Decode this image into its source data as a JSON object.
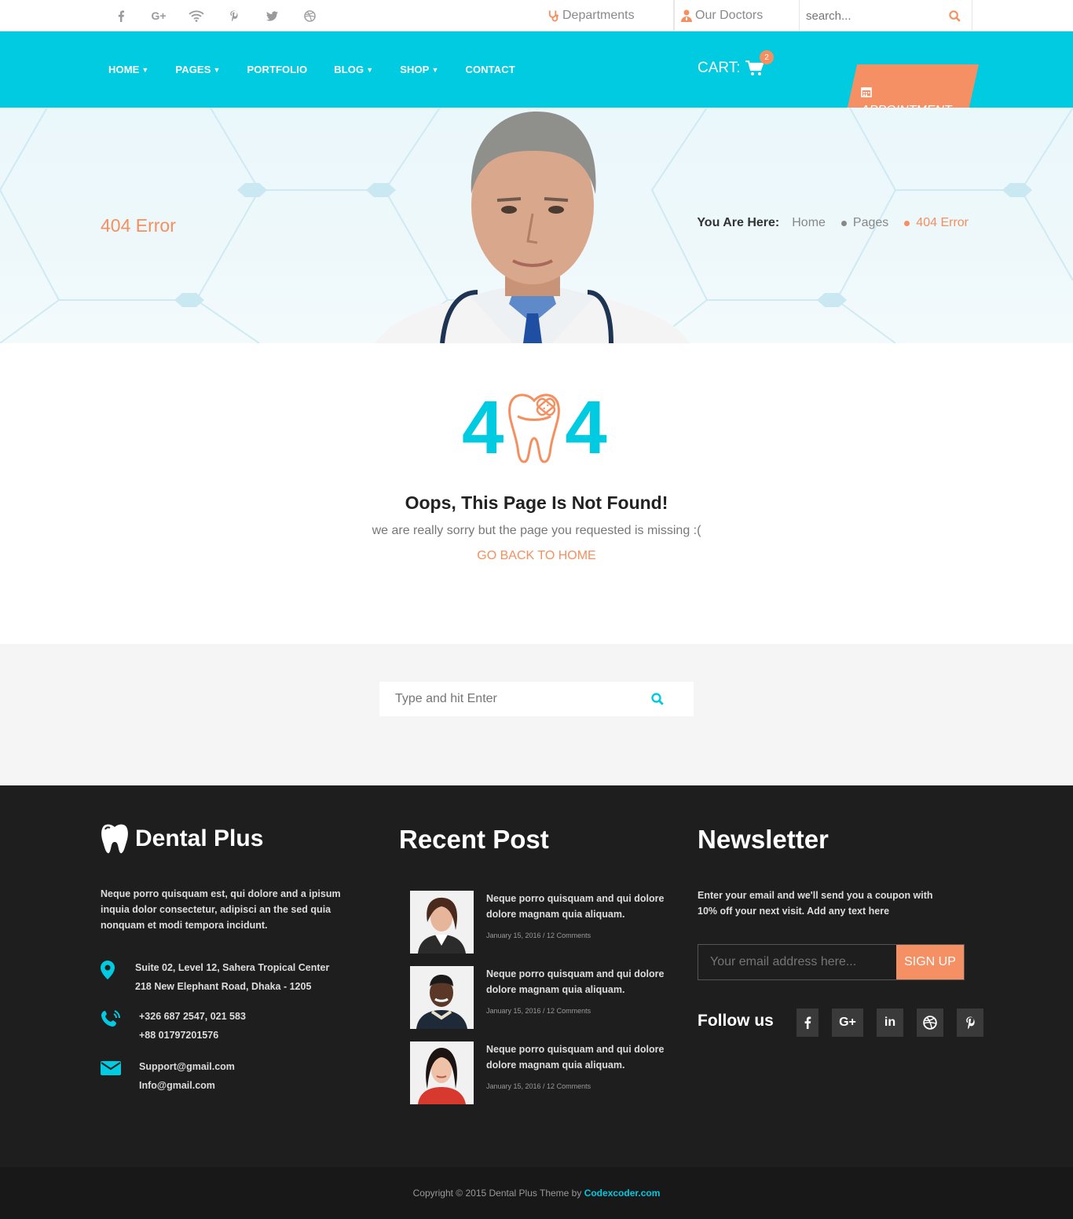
{
  "topbar": {
    "social": [
      "facebook-icon",
      "google-plus-icon",
      "wifi-icon",
      "pinterest-icon",
      "twitter-icon",
      "dribbble-icon"
    ],
    "departments": "Departments",
    "doctors": "Our Doctors",
    "search_placeholder": "search..."
  },
  "nav": {
    "items": [
      {
        "label": "HOME",
        "dropdown": true
      },
      {
        "label": "PAGES",
        "dropdown": true
      },
      {
        "label": "PORTFOLIO",
        "dropdown": false
      },
      {
        "label": "BLOG",
        "dropdown": true
      },
      {
        "label": "SHOP",
        "dropdown": true
      },
      {
        "label": "CONTACT",
        "dropdown": false
      }
    ],
    "cart_label": "CART:",
    "cart_count": "2",
    "appointment": "APPOINTMENT"
  },
  "banner": {
    "title": "404 Error",
    "breadcrumb_prefix": "You Are Here:",
    "crumbs": [
      "Home",
      "Pages",
      "404 Error"
    ]
  },
  "error": {
    "digit_left": "4",
    "digit_right": "4",
    "title": "Oops, This Page Is Not Found!",
    "subtitle": "we are really sorry but the page you requested is missing :(",
    "link": "GO BACK TO HOME"
  },
  "search": {
    "placeholder": "Type and hit Enter"
  },
  "footer": {
    "brand": "Dental Plus",
    "about": "Neque porro quisquam est, qui dolore and a ipisum inquia dolor consectetur, adipisci an the sed quia nonquam et modi tempora incidunt.",
    "address_1": "Suite 02, Level 12, Sahera Tropical Center",
    "address_2": "218 New Elephant Road, Dhaka - 1205",
    "phone_1": "+326 687 2547, 021 583",
    "phone_2": "+88 01797201576",
    "email_1": "Support@gmail.com",
    "email_2": "Info@gmail.com",
    "recent_heading": "Recent Post",
    "posts": [
      {
        "title": "Neque porro quisquam and qui dolore dolore magnam quia aliquam.",
        "meta": "January 15, 2016 / 12 Comments"
      },
      {
        "title": "Neque porro quisquam and qui dolore dolore magnam quia aliquam.",
        "meta": "January 15, 2016 / 12 Comments"
      },
      {
        "title": "Neque porro quisquam and qui dolore dolore magnam quia aliquam.",
        "meta": "January 15, 2016 / 12 Comments"
      }
    ],
    "newsletter_heading": "Newsletter",
    "newsletter_text": "Enter your email and we'll send you a coupon with 10% off your next visit. Add any text here",
    "email_placeholder": "Your email address here...",
    "signup": "SIGN UP",
    "follow": "Follow us",
    "follow_icons": [
      "facebook-icon",
      "google-plus-icon",
      "linkedin-icon",
      "dribbble-icon",
      "pinterest-icon"
    ],
    "copyright": "Copyright © 2015 Dental Plus Theme by",
    "copyright_link": "Codexcoder.com"
  },
  "colors": {
    "accent": "#00cbe1",
    "orange": "#f58f5f",
    "footer_bg": "#1e1e1e"
  }
}
